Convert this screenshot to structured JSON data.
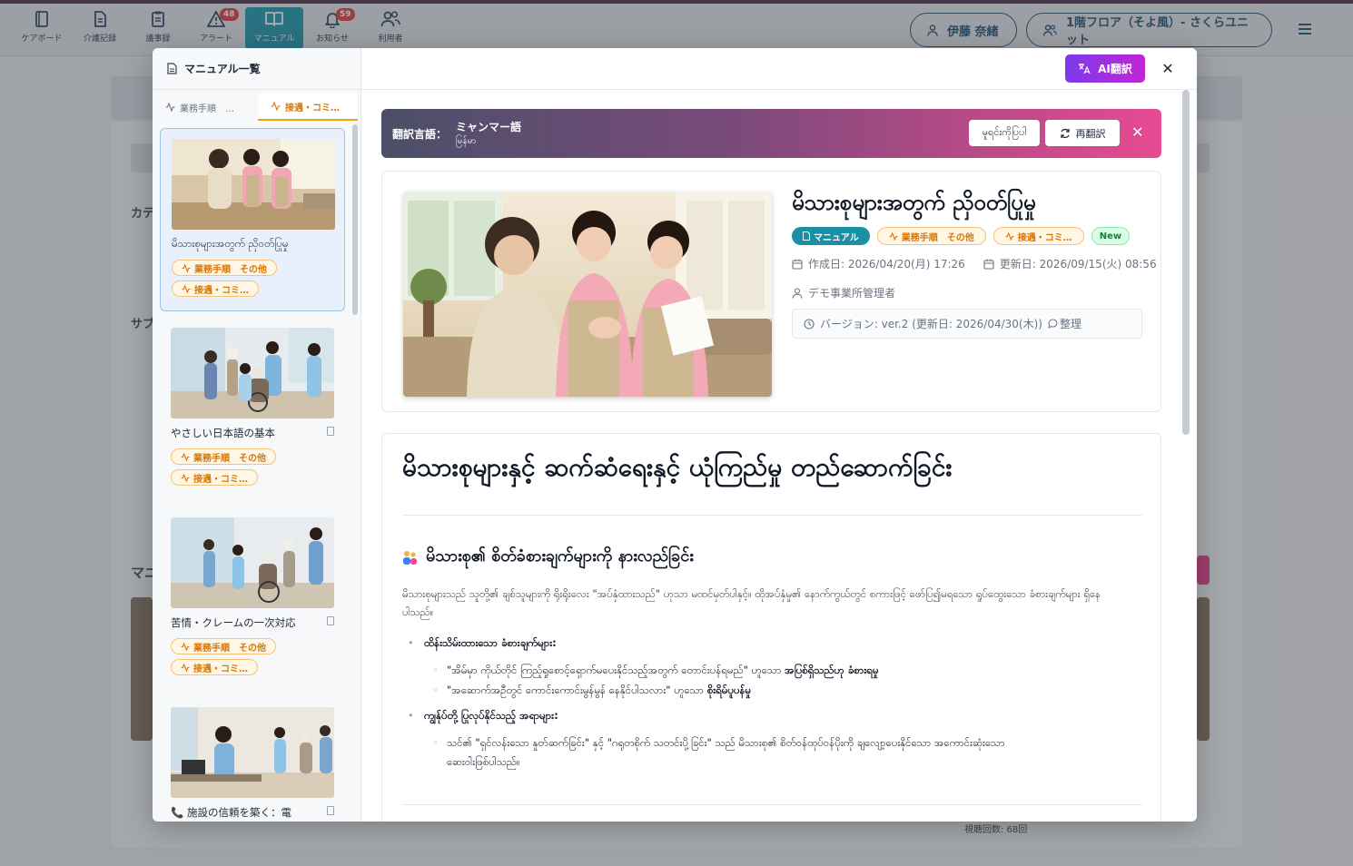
{
  "header": {
    "nav": [
      {
        "label": "ケアボード",
        "icon": "board-icon",
        "badge": null
      },
      {
        "label": "介護記録",
        "icon": "document-icon",
        "badge": null
      },
      {
        "label": "議事録",
        "icon": "clipboard-icon",
        "badge": null
      },
      {
        "label": "アラート",
        "icon": "alert-icon",
        "badge": "48"
      },
      {
        "label": "マニュアル",
        "icon": "book-icon",
        "badge": null
      },
      {
        "label": "お知らせ",
        "icon": "bell-icon",
        "badge": "59"
      },
      {
        "label": "利用者",
        "icon": "users-icon",
        "badge": null
      }
    ],
    "user_name": "伊藤 奈緒",
    "unit_name": "1階フロア（そよ風）- さくらユニット"
  },
  "sidebar": {
    "title": "マニュアル一覧",
    "tabs": [
      {
        "label": "業務手順　…"
      },
      {
        "label": "接遇・コミ…"
      }
    ],
    "items": [
      {
        "name": "မိသားစုများအတွက် ညှိဝတ်ပြုမှု",
        "tags": [
          "業務手順　その他",
          "接遇・コミ…"
        ]
      },
      {
        "name": "やさしい日本語の基本",
        "tags": [
          "業務手順　その他",
          "接遇・コミ…"
        ]
      },
      {
        "name": "苦情・クレームの一次対応",
        "tags": [
          "業務手順　その他",
          "接遇・コミ…"
        ]
      },
      {
        "name": "施設の信頼を築く：電",
        "tags": []
      }
    ]
  },
  "main": {
    "ai_button": "AI翻訳",
    "translation": {
      "label": "翻訳言語：",
      "language": "ミャンマー語",
      "native": "မြန်မာ",
      "original_button": "မူရင်းကိုပြပါ",
      "retranslate_button": "再翻訳"
    },
    "article": {
      "title": "မိသားစုများအတွက် ညှိဝတ်ပြုမှု",
      "tag_manual": "マニュアル",
      "tag_1": "業務手順　その他",
      "tag_2": "接遇・コミ…",
      "tag_new": "New",
      "created": "作成日: 2026/04/20(月) 17:26",
      "updated": "更新日: 2026/09/15(火) 08:56",
      "author": "デモ事業所管理者",
      "version": "バージョン: ver.2 (更新日: 2026/04/30(木))",
      "version_note": "整理"
    },
    "content": {
      "h1": "မိသားစုများနှင့် ဆက်ဆံရေးနှင့် ယုံကြည်မှု တည်ဆောက်ခြင်း",
      "h2": "မိသားစု၏ စိတ်ခံစားချက်များကို နားလည်ခြင်း",
      "para": "မိသားစုများသည် သူတို့၏ ချစ်သူများကို ရိုးရိုးလေး \"အပ်နှံထားသည်\" ဟုသာ မထင်မှတ်ပါနှင့်။ ထိုအပ်နှံမှု၏ နောက်ကွယ်တွင် စကားဖြင့် ဖော်ပြ၍မရသော ရှုပ်ထွေးသော ခံစားချက်များ ရှိနေပါသည်။",
      "b1_title": "ထိန်းသိမ်းထားသော ခံစားချက်များ:",
      "b1_s1_pre": "\"အိမ်မှာ ကိုယ်တိုင် ကြည့်ရှုစောင့်ရှောက်မပေးနိုင်သည့်အတွက် တောင်းပန်ရမည်\" ဟူသော ",
      "b1_s1_bold": "အပြစ်ရှိသည်ဟု ခံစားရမှု",
      "b1_s2_pre": "\"အဆောက်အဦတွင် ကောင်းကောင်းမွန်မွန် နေနိုင်ပါသလား\" ဟူသော ",
      "b1_s2_bold": "စိုးရိမ်ပူပန်မှု",
      "b2_title": "ကျွန်ုပ်တို့ ပြုလုပ်နိုင်သည့် အရာများ:",
      "b2_s1_l1": "သင်၏ \"ရှင်လန်းသော နှုတ်ဆက်ခြင်း\" နှင့် \"ဂရုတစိုက် သတင်းပို့ခြင်း\" သည် မိသားစု၏ စိတ်ဝန်ထုပ်ဝန်ပိုးကို ချလျော့ပေးနိုင်သော အကောင်းဆုံးသော",
      "b2_s1_l2": "ဆေးဝါးဖြစ်ပါသည်။"
    }
  },
  "background": {
    "label_category": "カテ",
    "label_sub": "サブ",
    "label_manual": "マニ",
    "views": "視聴回数: 68回"
  },
  "colors": {
    "accent": "#2a9db0",
    "ai_gradient_start": "#7c3aed",
    "ai_gradient_end": "#c026d3",
    "tag_orange": "#d97706"
  }
}
